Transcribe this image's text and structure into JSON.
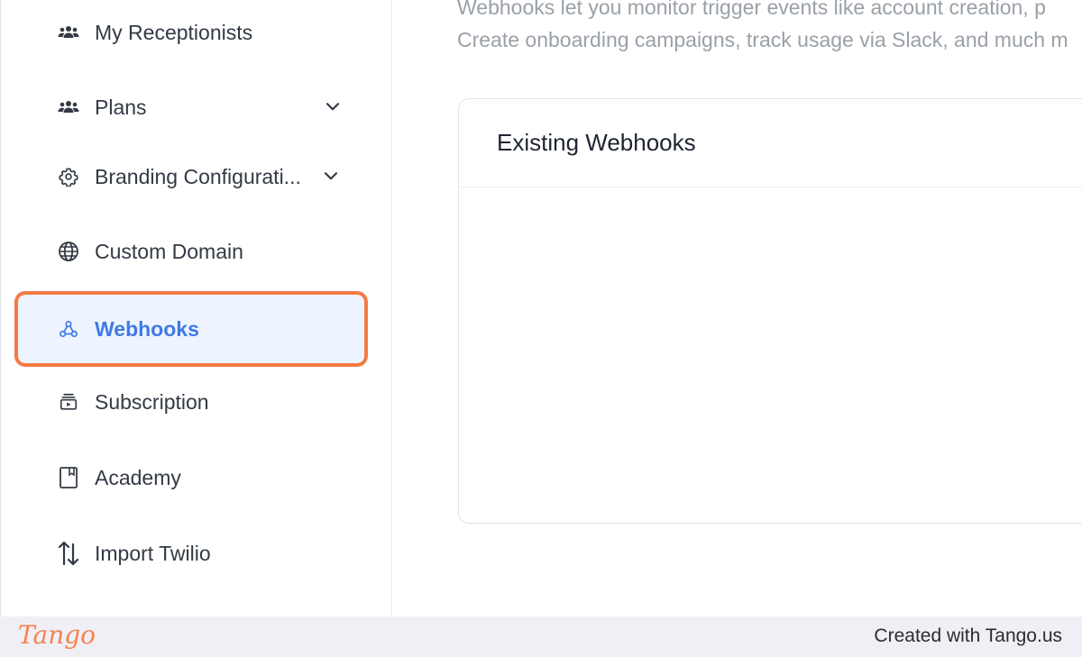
{
  "sidebar": {
    "items": [
      {
        "label": "My Receptionists",
        "icon": "group-icon",
        "has_chevron": false
      },
      {
        "label": "Plans",
        "icon": "group-icon",
        "has_chevron": true
      },
      {
        "label": "Branding Configurati...",
        "icon": "gear-icon",
        "has_chevron": true
      },
      {
        "label": "Custom Domain",
        "icon": "globe-icon",
        "has_chevron": false
      },
      {
        "label": "Webhooks",
        "icon": "webhook-icon",
        "has_chevron": false,
        "active": true
      },
      {
        "label": "Subscription",
        "icon": "subscription-icon",
        "has_chevron": false
      },
      {
        "label": "Academy",
        "icon": "book-icon",
        "has_chevron": false
      },
      {
        "label": "Import Twilio",
        "icon": "swap-vertical-icon",
        "has_chevron": false
      }
    ]
  },
  "main": {
    "description_line1": "Webhooks let you monitor trigger events like account creation, p",
    "description_line2": "Create onboarding campaigns, track usage via Slack, and much m",
    "card_title": "Existing Webhooks"
  },
  "footer": {
    "brand": "Tango",
    "credit": "Created with Tango.us"
  },
  "colors": {
    "accent": "#3f7ae6",
    "highlight": "#f47a45",
    "active_bg": "#eef4ff"
  }
}
